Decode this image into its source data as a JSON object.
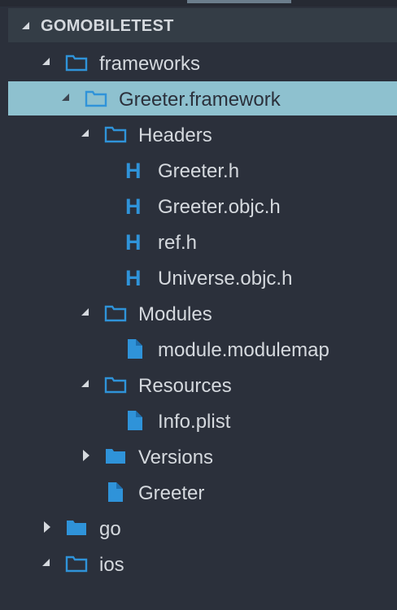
{
  "explorer": {
    "section_title": "GOMOBILETEST",
    "colors": {
      "background": "#2b303b",
      "section_header": "#343d46",
      "selection": "#8ec1cf",
      "icon_blue": "#2f93d9",
      "text": "#d5d9de"
    },
    "items": [
      {
        "label": "frameworks",
        "kind": "folder-open",
        "expanded": true
      },
      {
        "label": "Greeter.framework",
        "kind": "folder-open",
        "expanded": true,
        "selected": true
      },
      {
        "label": "Headers",
        "kind": "folder-open",
        "expanded": true
      },
      {
        "label": "Greeter.h",
        "kind": "header-file"
      },
      {
        "label": "Greeter.objc.h",
        "kind": "header-file"
      },
      {
        "label": "ref.h",
        "kind": "header-file"
      },
      {
        "label": "Universe.objc.h",
        "kind": "header-file"
      },
      {
        "label": "Modules",
        "kind": "folder-open",
        "expanded": true
      },
      {
        "label": "module.modulemap",
        "kind": "file"
      },
      {
        "label": "Resources",
        "kind": "folder-open",
        "expanded": true
      },
      {
        "label": "Info.plist",
        "kind": "file"
      },
      {
        "label": "Versions",
        "kind": "folder-closed",
        "expanded": false
      },
      {
        "label": "Greeter",
        "kind": "file"
      },
      {
        "label": "go",
        "kind": "folder-closed",
        "expanded": false
      },
      {
        "label": "ios",
        "kind": "folder-open",
        "expanded": true
      }
    ],
    "header_icon_glyph": "H"
  }
}
